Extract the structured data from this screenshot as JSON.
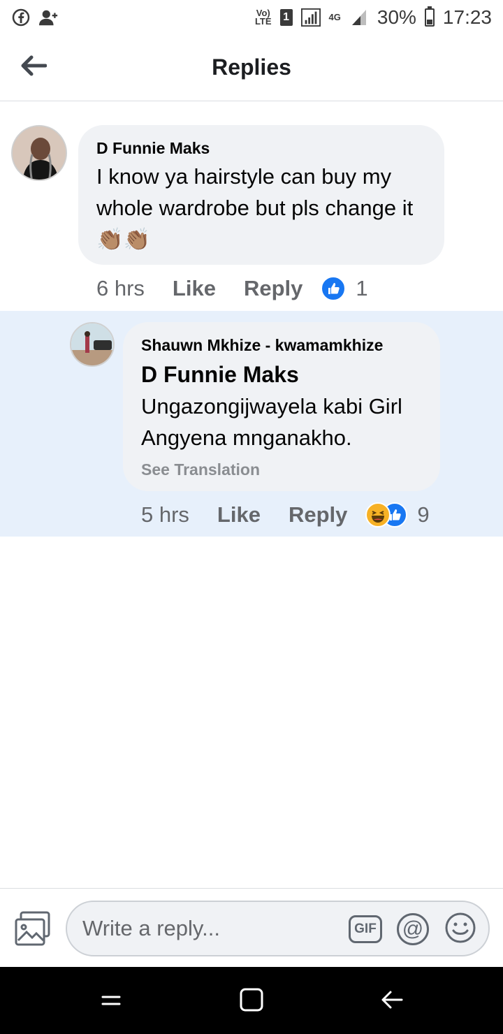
{
  "status_bar": {
    "volte": "Vo)\nLTE",
    "sim": "1",
    "network": "4G",
    "battery": "30%",
    "battery_level": 0.3,
    "time": "17:23"
  },
  "header": {
    "title": "Replies"
  },
  "comments": [
    {
      "author": "D Funnie Maks",
      "text": "I know ya hairstyle can buy my whole wardrobe but pls change it👏🏽👏🏽",
      "time": "6 hrs",
      "like_label": "Like",
      "reply_label": "Reply",
      "reaction_count": "1"
    },
    {
      "author": "Shauwn Mkhize - kwamamkhize",
      "mention": "D Funnie Maks",
      "text": "Ungazongijwayela kabi Girl Angyena mnganakho.",
      "see_translation": "See Translation",
      "time": "5 hrs",
      "like_label": "Like",
      "reply_label": "Reply",
      "reaction_count": "9"
    }
  ],
  "composer": {
    "placeholder": "Write a reply...",
    "gif_label": "GIF",
    "at_label": "@"
  },
  "colors": {
    "accent": "#1877f2",
    "highlight": "#e7f0fb",
    "bubble": "#f0f2f5"
  }
}
